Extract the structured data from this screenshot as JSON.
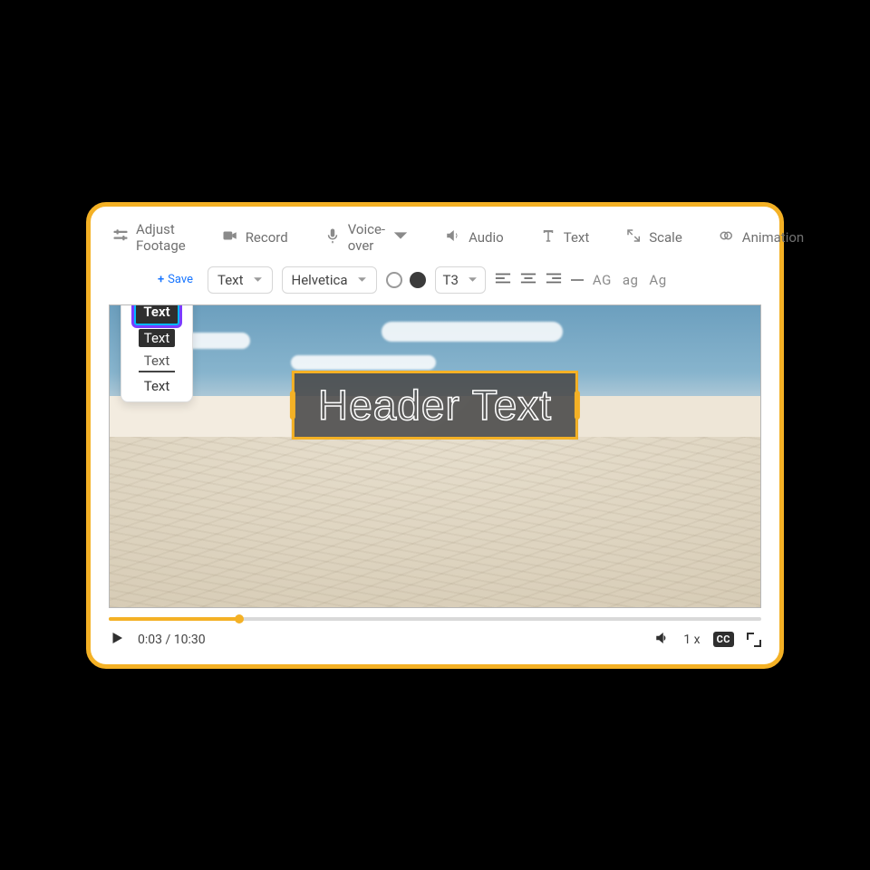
{
  "toolbar": {
    "adjust_footage": "Adjust Footage",
    "record": "Record",
    "voice_over": "Voice-over",
    "audio": "Audio",
    "text": "Text",
    "scale": "Scale",
    "animation": "Animation"
  },
  "format": {
    "save_label": "Save",
    "style_selector": "Text",
    "font_selector": "Helvetica",
    "size_selector": "T3",
    "caps_upper": "AG",
    "caps_lower": "ag",
    "caps_title": "Ag"
  },
  "text_style_options": [
    "Text",
    "Text",
    "Text",
    "Text"
  ],
  "preview": {
    "overlay_text": "Header Text"
  },
  "player": {
    "elapsed": "0:03",
    "total": "10:30",
    "speed": "1 x",
    "cc": "CC"
  },
  "colors": {
    "accent": "#f4b125",
    "highlight_cyan": "#00b8ff",
    "highlight_purple": "#7a3cff"
  }
}
